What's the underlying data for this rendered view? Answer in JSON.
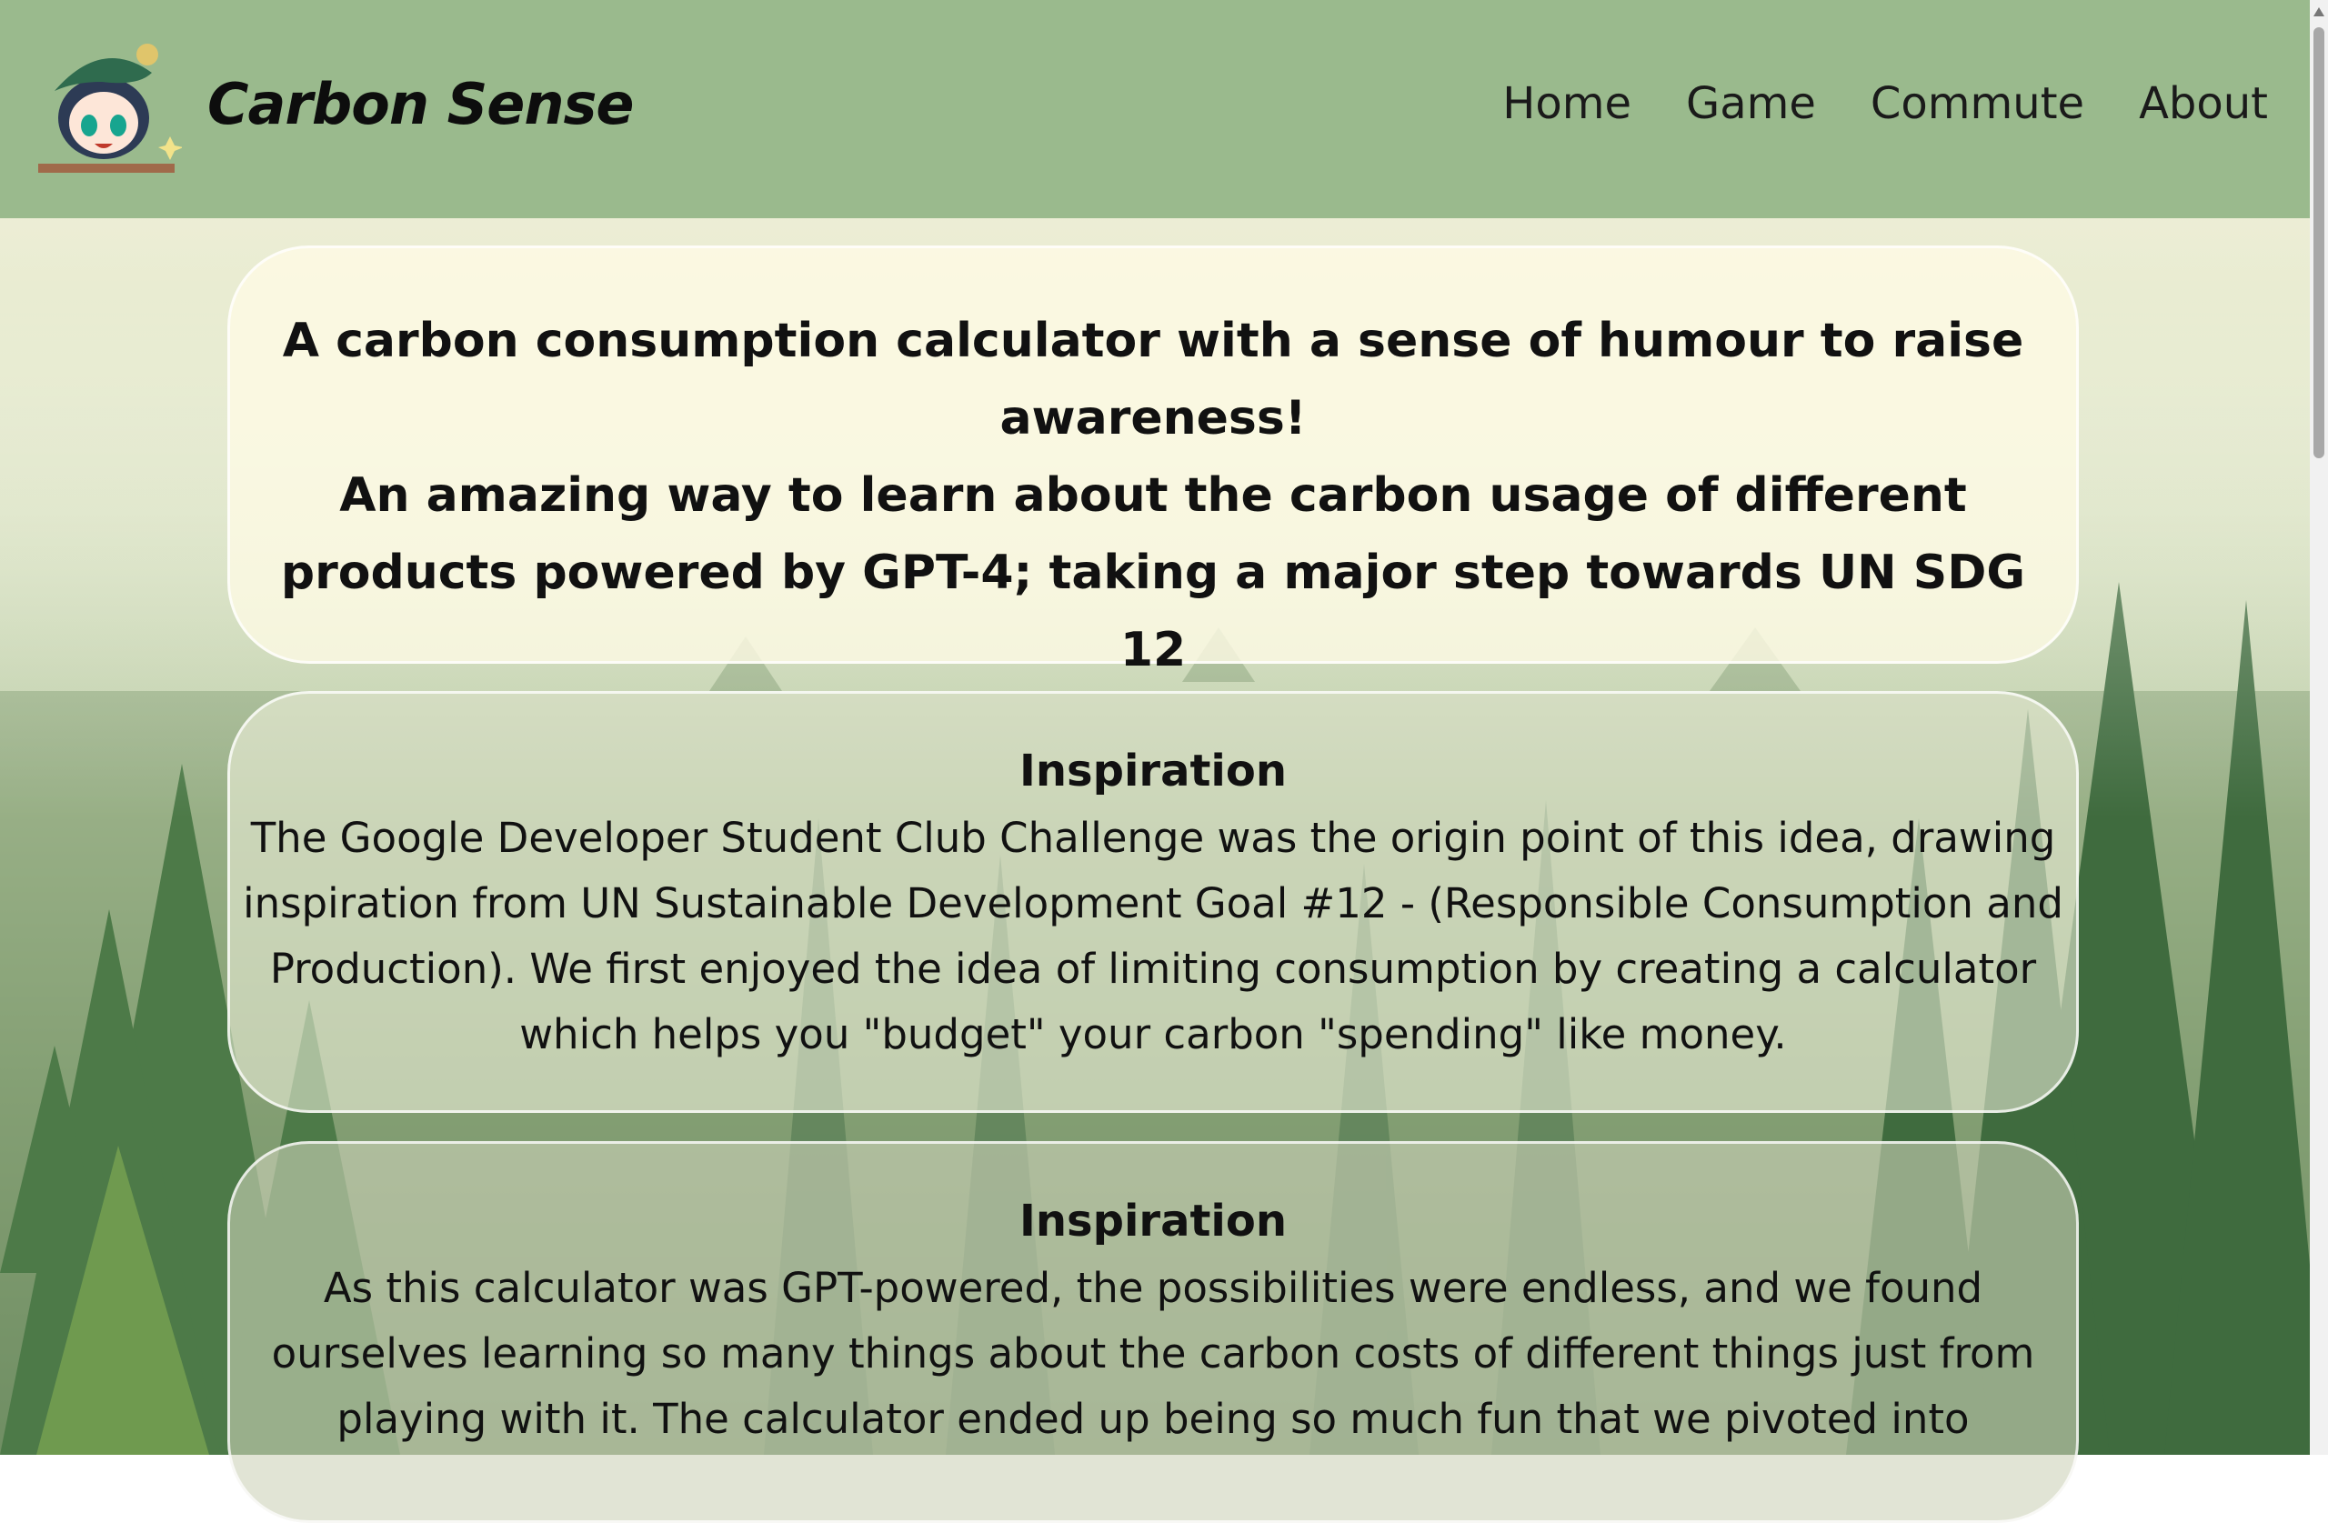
{
  "header": {
    "brand": "Carbon Sense",
    "logo_icon": "chibi-character-logo-icon",
    "nav": [
      "Home",
      "Game",
      "Commute",
      "About"
    ]
  },
  "hero": {
    "line1": "A carbon consumption calculator with a sense of humour to raise awareness!",
    "line2": "An amazing way to learn about the carbon usage of different products powered by GPT-4; taking a major step towards UN SDG 12"
  },
  "sections": [
    {
      "title": "Inspiration",
      "body": "The Google Developer Student Club Challenge was the origin point of this idea, drawing inspiration from UN Sustainable Development Goal #12 - (Responsible Consumption and Production). We first enjoyed the idea of limiting consumption by creating a calculator which helps you \"budget\" your carbon \"spending\" like money."
    },
    {
      "title": "Inspiration",
      "body": "As this calculator was GPT-powered, the possibilities were endless, and we found ourselves learning so many things about the carbon costs of different things just from playing with it. The calculator ended up being so much fun that we pivoted into"
    }
  ],
  "colors": {
    "header_bg": "#9aba8d",
    "text": "#111111"
  }
}
